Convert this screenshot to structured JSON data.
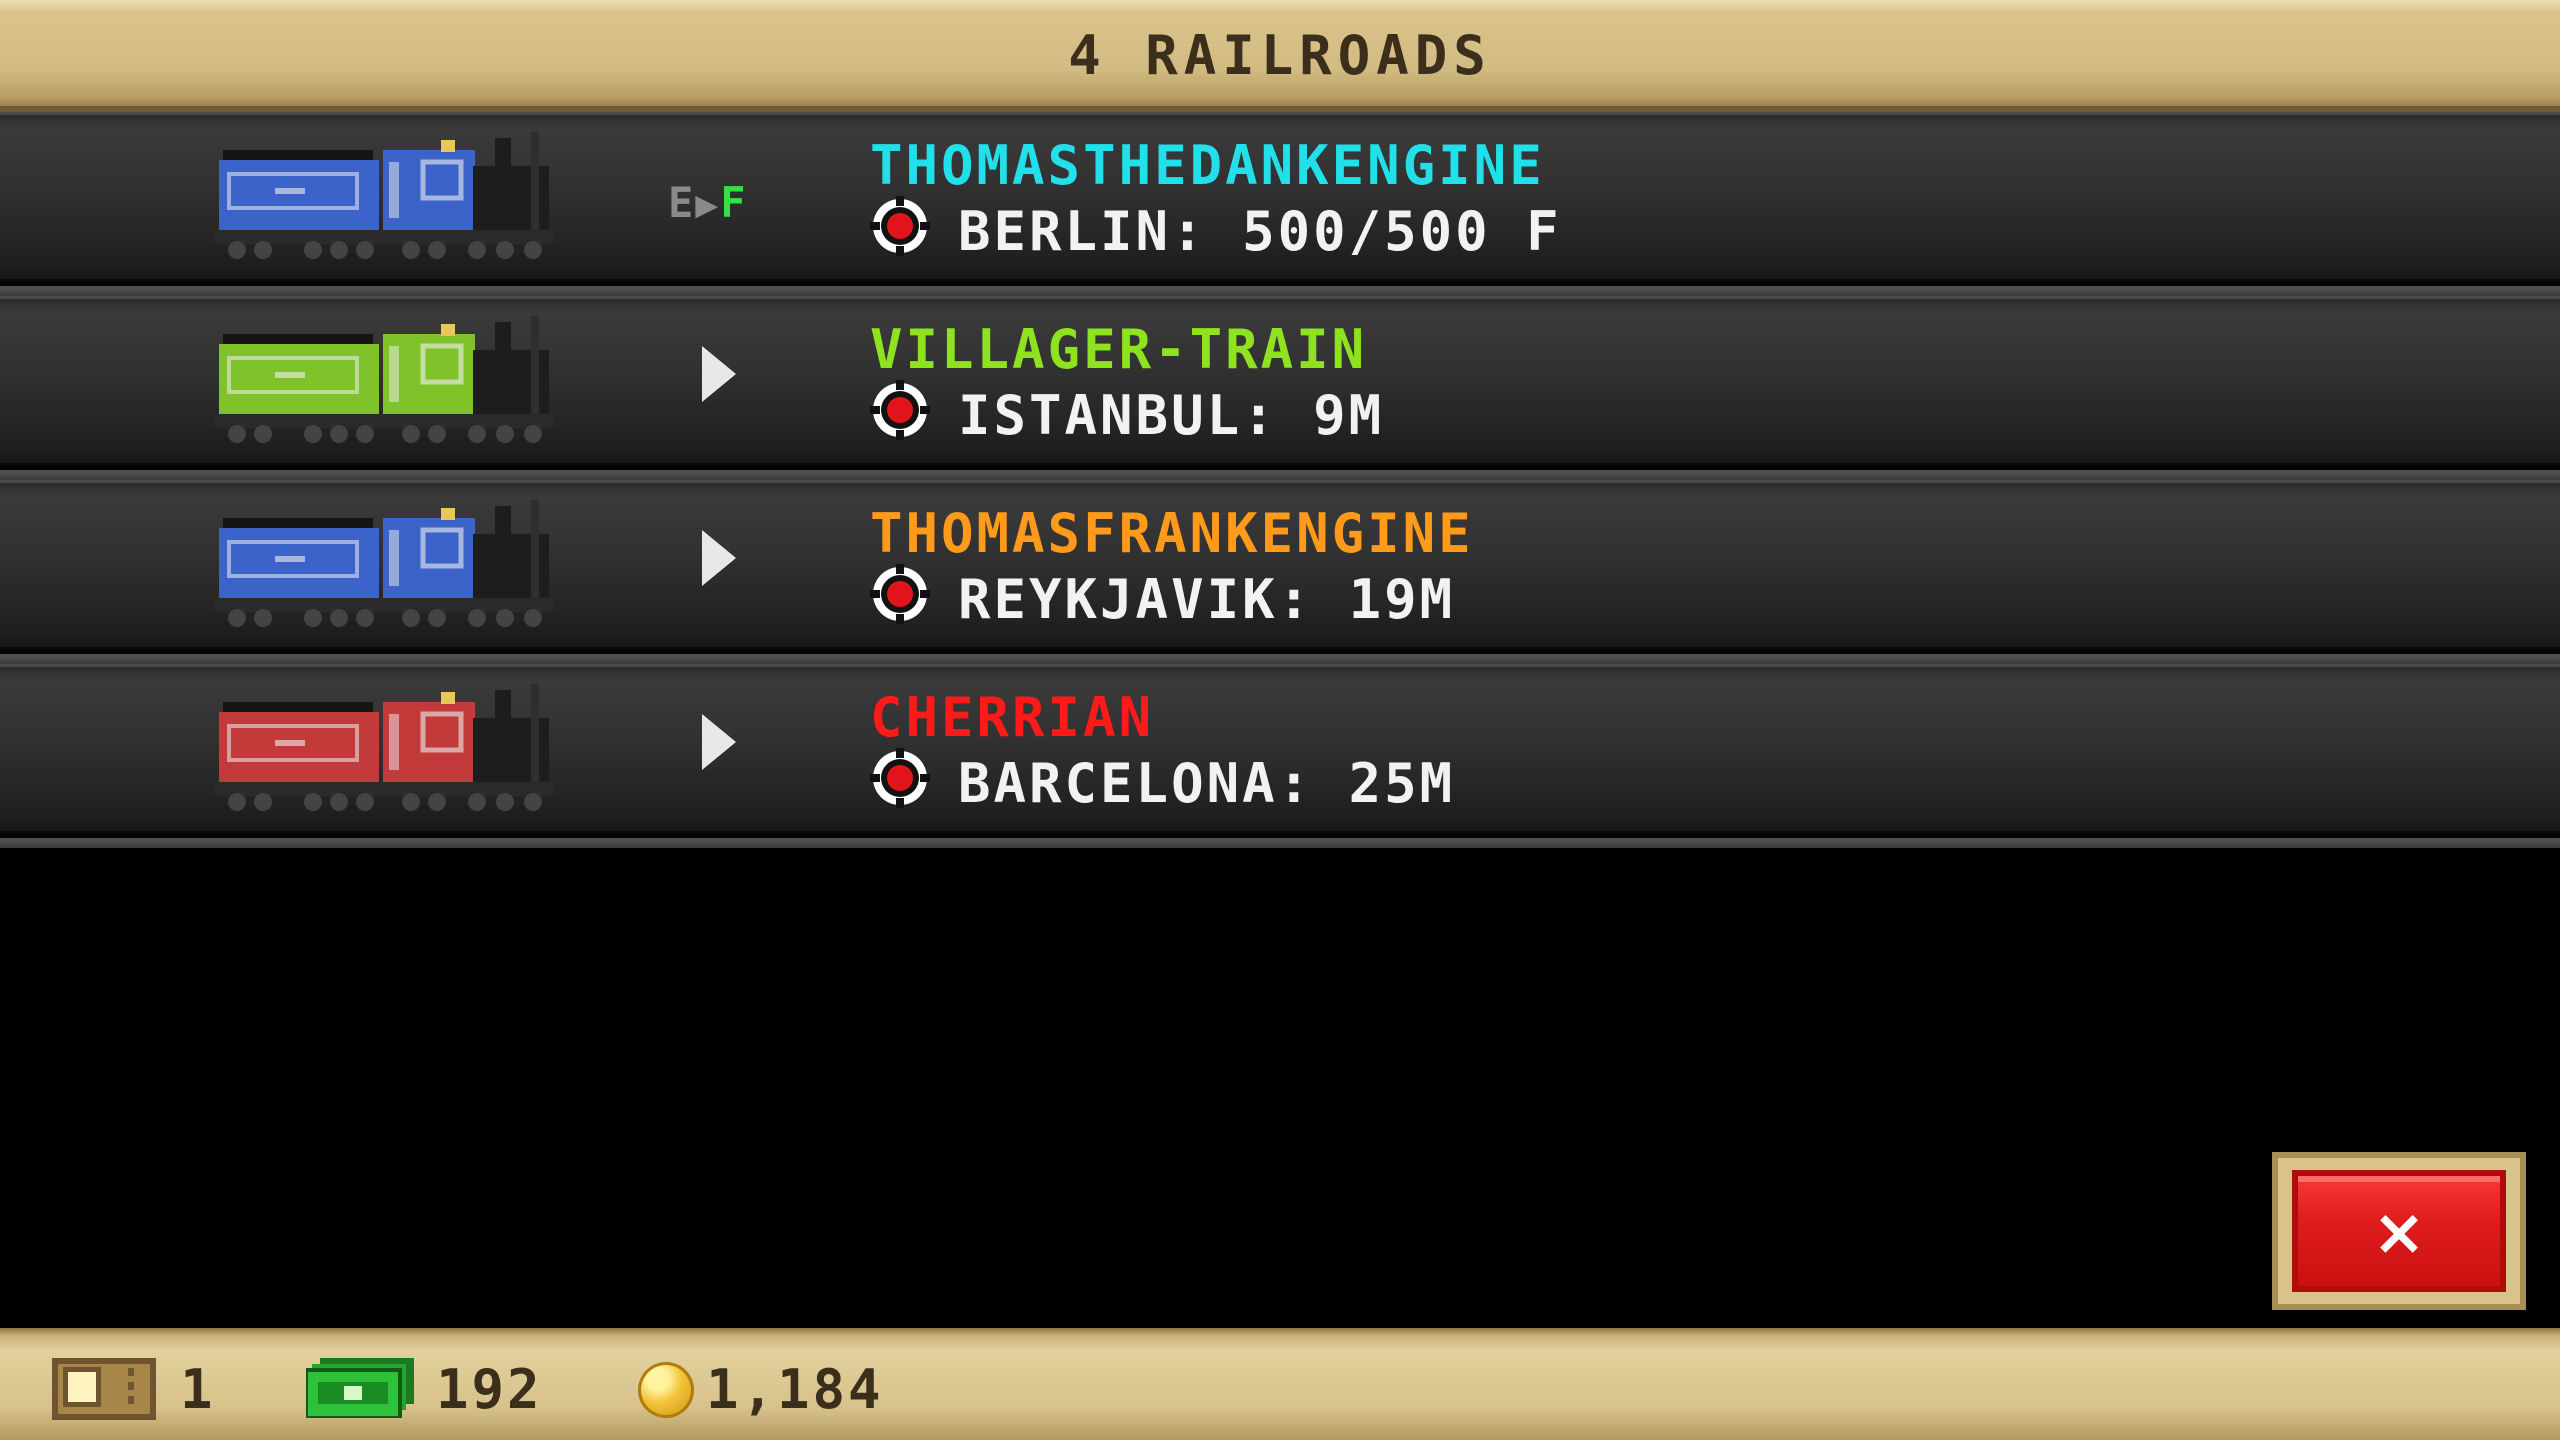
{
  "header": {
    "title": "4 RAILROADS"
  },
  "trains": [
    {
      "name": "THOMASTHEDANKENGINE",
      "name_color": "#22e0ea",
      "body_color": "#3b63c9",
      "status_type": "cargo",
      "cargo_status": {
        "empty": "E",
        "full": "F"
      },
      "route": "BERLIN: 500/500 F"
    },
    {
      "name": "VILLAGER-TRAIN",
      "name_color": "#8fe21f",
      "body_color": "#7fc22a",
      "status_type": "moving",
      "route": "ISTANBUL: 9M"
    },
    {
      "name": "THOMASFRANKENGINE",
      "name_color": "#ff9a1a",
      "body_color": "#3b63c9",
      "status_type": "moving",
      "route": "REYKJAVIK: 19M"
    },
    {
      "name": "CHERRIAN",
      "name_color": "#ff1a1a",
      "body_color": "#c23a3a",
      "status_type": "moving",
      "route": "BARCELONA: 25M"
    }
  ],
  "close_button": {
    "label": "×"
  },
  "footer": {
    "tickets": "1",
    "cash": "192",
    "coins": "1,184"
  },
  "icons": {
    "train": "steam-locomotive-icon",
    "station": "station-marker-icon",
    "play": "play-icon",
    "ticket": "ticket-icon",
    "cash": "cash-icon",
    "coin": "coin-icon",
    "close": "close-icon"
  }
}
